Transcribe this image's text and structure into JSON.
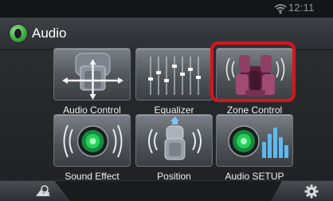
{
  "status_bar": {
    "time": "12:11",
    "wifi_icon": "wifi-icon"
  },
  "header": {
    "title": "Audio",
    "back_icon": "back-icon"
  },
  "tiles": [
    {
      "label": "Audio Control",
      "icon": "audio-control-icon"
    },
    {
      "label": "Equalizer",
      "icon": "equalizer-icon"
    },
    {
      "label": "Zone Control",
      "icon": "zone-control-icon",
      "highlighted": true
    },
    {
      "label": "Sound Effect",
      "icon": "sound-effect-icon"
    },
    {
      "label": "Position",
      "icon": "position-icon"
    },
    {
      "label": "Audio SETUP",
      "icon": "audio-setup-icon"
    }
  ],
  "bottom_bar": {
    "left_icon": "search-icon",
    "right_icon": "gear-icon"
  },
  "colors": {
    "highlight": "#d9141c",
    "accent_green": "#3fa943",
    "speaker_green": "#25d15a"
  }
}
